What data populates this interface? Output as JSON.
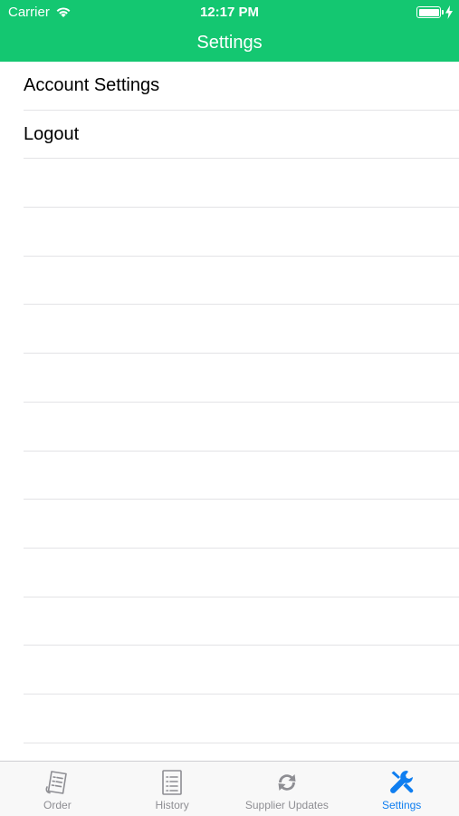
{
  "status_bar": {
    "carrier": "Carrier",
    "time": "12:17 PM"
  },
  "nav": {
    "title": "Settings"
  },
  "settings_list": [
    {
      "label": "Account Settings"
    },
    {
      "label": "Logout"
    },
    {
      "label": ""
    },
    {
      "label": ""
    },
    {
      "label": ""
    },
    {
      "label": ""
    },
    {
      "label": ""
    },
    {
      "label": ""
    },
    {
      "label": ""
    },
    {
      "label": ""
    },
    {
      "label": ""
    },
    {
      "label": ""
    },
    {
      "label": ""
    },
    {
      "label": ""
    }
  ],
  "tabs": [
    {
      "label": "Order",
      "icon": "order-icon",
      "active": false
    },
    {
      "label": "History",
      "icon": "history-icon",
      "active": false
    },
    {
      "label": "Supplier Updates",
      "icon": "refresh-icon",
      "active": false
    },
    {
      "label": "Settings",
      "icon": "wrench-screwdriver-icon",
      "active": true
    }
  ],
  "colors": {
    "brand_green": "#14c771",
    "tab_active": "#0f7ef0",
    "tab_inactive": "#8e8e93"
  }
}
